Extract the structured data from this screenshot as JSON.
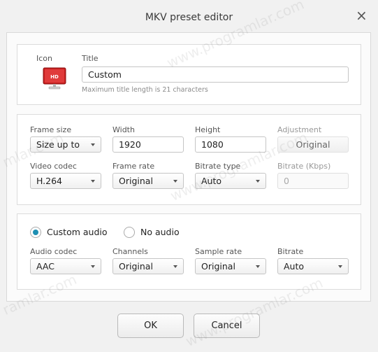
{
  "window": {
    "title": "MKV preset editor",
    "close_glyph": "×"
  },
  "icon_section": {
    "icon_label": "Icon",
    "icon_badge": "HD",
    "title_label": "Title",
    "title_value": "Custom",
    "title_hint": "Maximum title length is 21 characters"
  },
  "video": {
    "frame_size_label": "Frame size",
    "frame_size_value": "Size up to",
    "width_label": "Width",
    "width_value": "1920",
    "height_label": "Height",
    "height_value": "1080",
    "adjustment_label": "Adjustment",
    "adjustment_value": "Original",
    "video_codec_label": "Video codec",
    "video_codec_value": "H.264",
    "frame_rate_label": "Frame rate",
    "frame_rate_value": "Original",
    "bitrate_type_label": "Bitrate type",
    "bitrate_type_value": "Auto",
    "bitrate_label": "Bitrate (Kbps)",
    "bitrate_value": "0"
  },
  "audio": {
    "custom_audio_label": "Custom audio",
    "no_audio_label": "No audio",
    "selected_option": "Custom audio",
    "audio_codec_label": "Audio codec",
    "audio_codec_value": "AAC",
    "channels_label": "Channels",
    "channels_value": "Original",
    "sample_rate_label": "Sample rate",
    "sample_rate_value": "Original",
    "bitrate_label": "Bitrate",
    "bitrate_value": "Auto"
  },
  "footer": {
    "ok_label": "OK",
    "cancel_label": "Cancel"
  },
  "watermark": {
    "text": "www.programlar.com",
    "text_short": "mlar.com",
    "text_tail": "ramlar.com"
  },
  "colors": {
    "accent": "#1e8fb3",
    "icon_red": "#d22a2a"
  },
  "icons": [
    "hd-monitor-icon",
    "close-icon",
    "chevron-down-icon"
  ]
}
